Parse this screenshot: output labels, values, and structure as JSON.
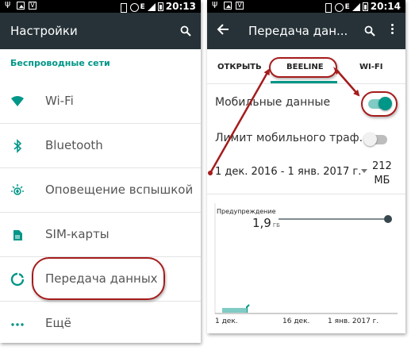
{
  "left_screen": {
    "status_bar": {
      "time": "20:13",
      "network": "E"
    },
    "toolbar": {
      "title": "Настройки"
    },
    "section_header": "Беспроводные сети",
    "items": [
      {
        "label": "Wi-Fi",
        "icon": "wifi-icon"
      },
      {
        "label": "Bluetooth",
        "icon": "bluetooth-icon"
      },
      {
        "label": "Оповещение вспышкой",
        "icon": "flash-icon"
      },
      {
        "label": "SIM-карты",
        "icon": "sim-card-icon"
      },
      {
        "label": "Передача данных",
        "icon": "data-usage-icon"
      },
      {
        "label": "Ещё",
        "icon": "more-icon"
      }
    ]
  },
  "right_screen": {
    "status_bar": {
      "time": "20:14",
      "network": "E"
    },
    "toolbar": {
      "title": "Передача дан..."
    },
    "tabs": [
      {
        "label": "ОТКРЫТЬ"
      },
      {
        "label": "BEELINE"
      },
      {
        "label": "WI-FI"
      }
    ],
    "mobile_data": {
      "label": "Мобильные данные",
      "enabled": true
    },
    "mobile_limit": {
      "label": "Лимит мобильного траф..",
      "enabled": false
    },
    "date_range": "1 дек. 2016 - 1 янв. 2017 г.",
    "usage": {
      "value": "212",
      "unit": "МБ"
    },
    "chart": {
      "warning_label": "Предупреждение",
      "warning_value": "1,9",
      "warning_unit": "ГБ",
      "ticks": [
        "1 дек.",
        "16 дек.",
        "1 янв. 2017 г."
      ]
    }
  },
  "colors": {
    "toolbar": "#263238",
    "accent": "#009688",
    "annotation": "#a51c1c"
  }
}
